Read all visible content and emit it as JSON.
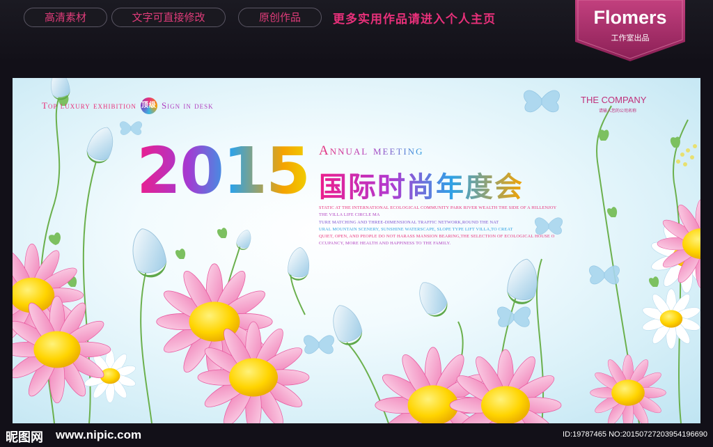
{
  "top_bar": {
    "pills": [
      "高清素材",
      "文字可直接修改",
      "原创作品"
    ],
    "promo": "更多实用作品请进入个人主页"
  },
  "brand": {
    "name": "Flomers",
    "subtitle": "工作室出品"
  },
  "poster": {
    "tagline_1": "Top luxury exhibition",
    "badge": "顶级",
    "tagline_2": "Sign in desk",
    "company": "THE COMPANY",
    "company_sub": "请输入您的公司名称",
    "year": "2015",
    "annual": "Annual meeting",
    "cn_title": "国际时尚年度会",
    "body_lines": [
      "STATIC AT THE INTERNATIONAL ECOLOGICAL COMMUNITY PARK RIVER WEALTH THE SIDE OF A HILLENJOY",
      "THE VILLA LIFE CIRCLE MA",
      "TURE MATCHING AND THREE-DIMENSIONAL TRAFFIC NETWORK,ROUND THE NAT",
      "URAL MOUNTAIN SCENERY, SUNSHINE WATERSCAPE, SLOPE TYPE LIFT VILLA,TO CREAT",
      "QUIET, OPEN, AND PEOPLE DO NOT HARASS MANSION BEARING,THE SELECTION OF ECOLOGICAL HOUSE O",
      "CCUPANCY, MORE HEALTH AND HAPPINESS TO THE FAMILY."
    ],
    "body_colors": [
      "#e8307a",
      "#b040c0",
      "#7a4fd0",
      "#2a9ee0",
      "#e8307a",
      "#b040c0"
    ]
  },
  "footer": {
    "logo": "昵图网",
    "url": "www.nipic.com",
    "id_text": "ID:19787465 NO:20150727203954196690"
  },
  "colors": {
    "accent": "#e8307a",
    "background": "#121018"
  }
}
